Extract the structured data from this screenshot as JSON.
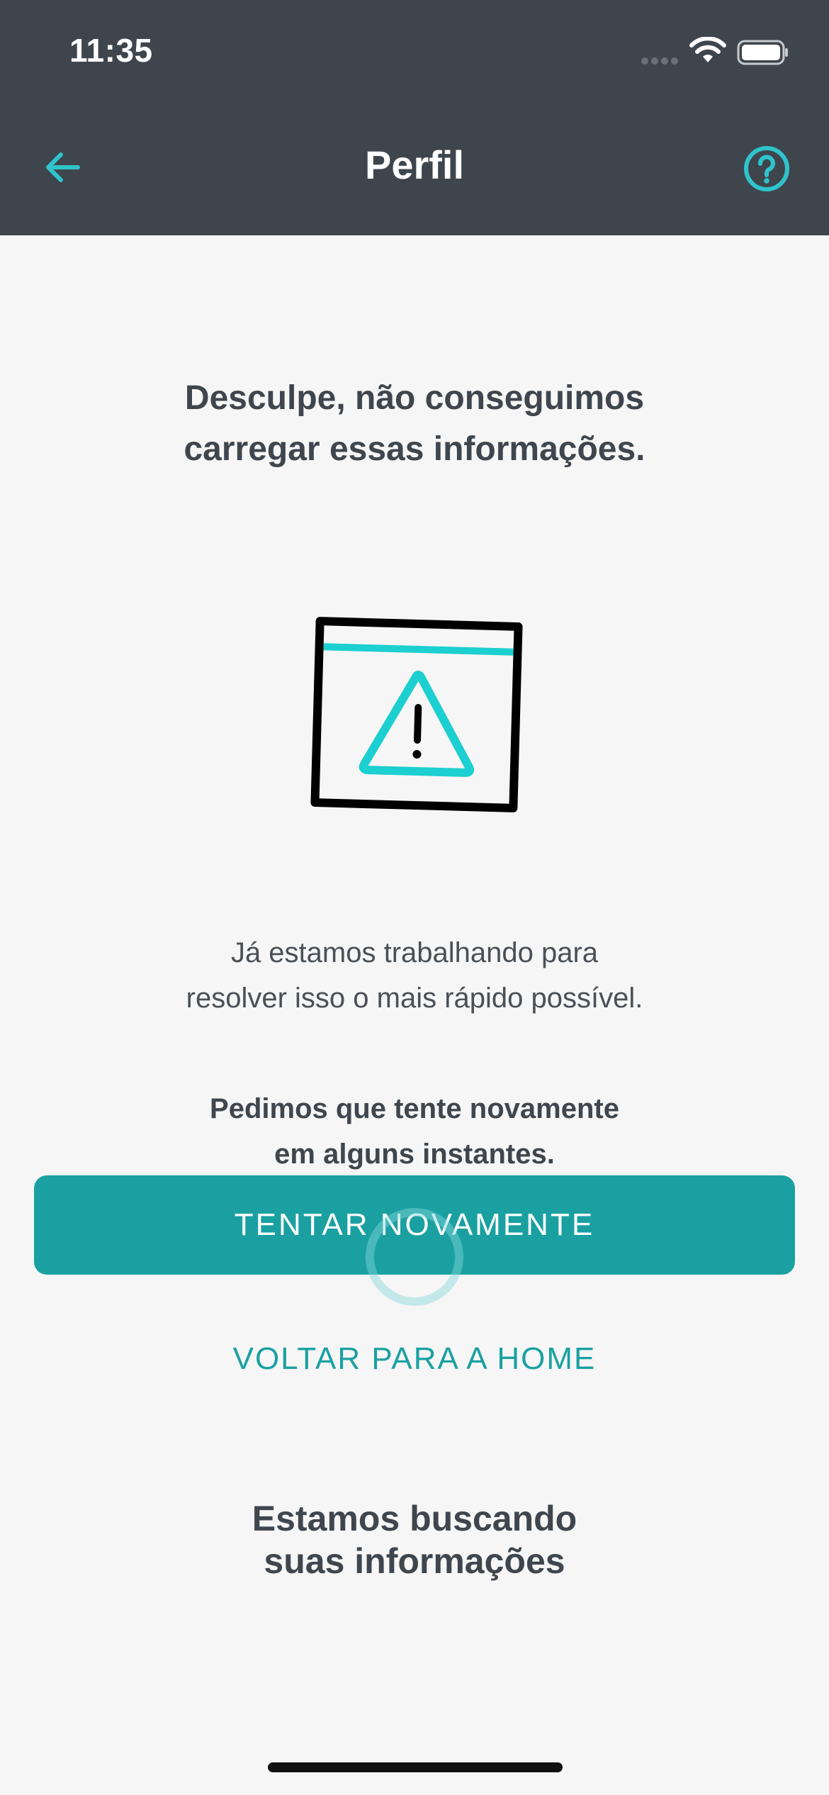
{
  "status_bar": {
    "time": "11:35"
  },
  "nav": {
    "title": "Perfil",
    "back_icon": "arrow-left-icon",
    "help_icon": "question-circle-icon"
  },
  "content": {
    "error_title": "Desculpe, não conseguimos\ncarregar essas informações.",
    "illustration_icon": "window-warning-icon",
    "error_description": "Já estamos trabalhando para\nresolver isso o mais rápido possível.",
    "retry_note": "Pedimos que tente novamente\nem alguns instantes.",
    "retry_button_label": "TENTAR NOVAMENTE",
    "home_link_label": "VOLTAR PARA A HOME",
    "loading_text": "Estamos buscando\nsuas informações"
  },
  "colors": {
    "header_bg": "#3e454c",
    "accent": "#1ba0a2",
    "icon_accent": "#2fc4cc",
    "background": "#f6f6f6",
    "text_dark": "#3f464d"
  }
}
